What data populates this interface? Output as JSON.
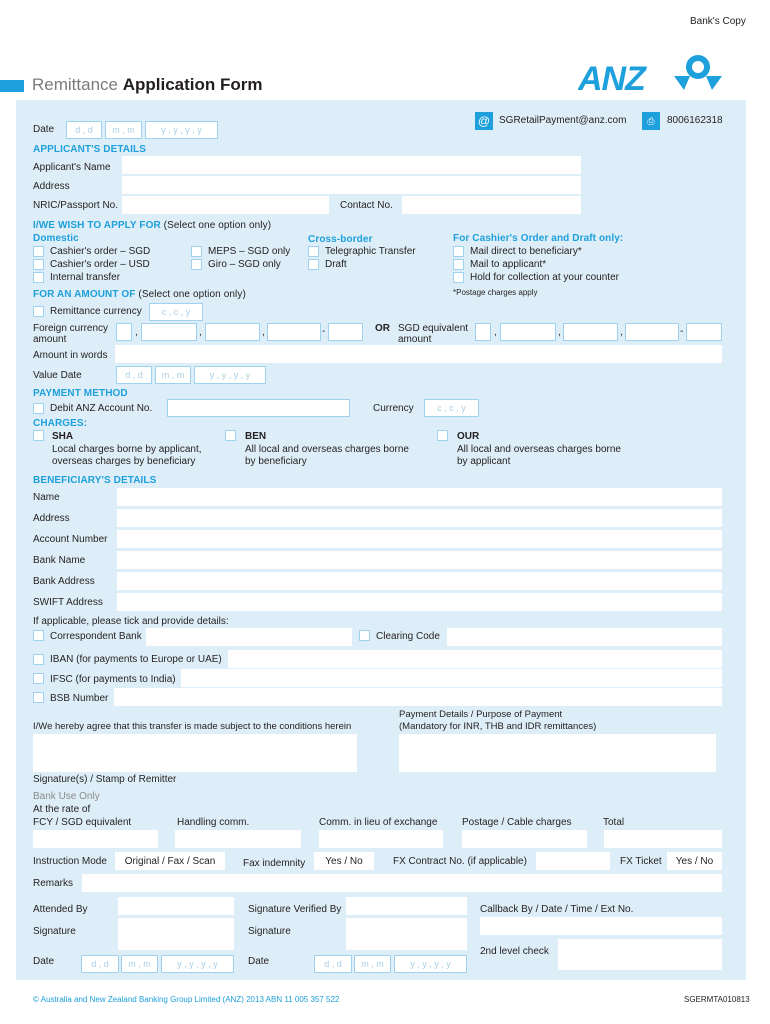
{
  "header": {
    "copy_label": "Bank's Copy",
    "title_light": "Remittance",
    "title_bold": "Application Form",
    "logo_text": "ANZ",
    "email": "SGRetailPayment@anz.com",
    "phone": "8006162318",
    "brand_color": "#1ea0dc"
  },
  "date": {
    "label": "Date",
    "dd": "d , d",
    "mm": "m , m",
    "yyyy": "y , y , y , y"
  },
  "applicant": {
    "heading": "APPLICANT'S DETAILS",
    "name_label": "Applicant's Name",
    "address_label": "Address",
    "nric_label": "NRIC/Passport No.",
    "contact_label": "Contact No."
  },
  "apply_for": {
    "heading": "I/WE WISH TO APPLY FOR",
    "heading_note": "(Select one option only)",
    "domestic_heading": "Domestic",
    "domestic_col1": [
      "Cashier's order – SGD",
      "Cashier's order – USD",
      "Internal transfer"
    ],
    "domestic_col2": [
      "MEPS – SGD only",
      "Giro  – SGD only"
    ],
    "crossborder_heading": "Cross-border",
    "crossborder": [
      "Telegraphic Transfer",
      "Draft"
    ],
    "cashier_heading": "For Cashier's Order and Draft only:",
    "cashier": [
      "Mail direct to beneficiary*",
      "Mail to applicant*",
      "Hold for collection at your counter"
    ],
    "postage_note": "*Postage charges apply"
  },
  "amount": {
    "heading": "FOR AN AMOUNT OF",
    "heading_note": "(Select one option only)",
    "remit_currency_label": "Remittance currency",
    "ccy": "c , c , y",
    "foreign_label_1": "Foreign currency",
    "foreign_label_2": "amount",
    "or_label": "OR",
    "sgd_label_1": "SGD equivalent",
    "sgd_label_2": "amount",
    "comma": ",",
    "dash": "-",
    "words_label": "Amount in words",
    "value_date_label": "Value Date"
  },
  "payment": {
    "heading": "PAYMENT METHOD",
    "debit_label": "Debit ANZ Account No.",
    "currency_label": "Currency",
    "ccy": "c , c , y"
  },
  "charges": {
    "heading": "CHARGES:",
    "options": [
      {
        "code": "SHA",
        "line1": "Local charges borne by applicant,",
        "line2": "overseas charges by beneficiary"
      },
      {
        "code": "BEN",
        "line1": "All local and overseas charges borne",
        "line2": "by beneficiary"
      },
      {
        "code": "OUR",
        "line1": "All local and overseas charges borne",
        "line2": "by applicant"
      }
    ]
  },
  "beneficiary": {
    "heading": "BENEFICIARY'S DETAILS",
    "fields": [
      "Name",
      "Address",
      "Account Number",
      "Bank Name",
      "Bank Address",
      "SWIFT Address"
    ],
    "applicable_note": "If applicable, please tick and provide details:",
    "correspondent_label": "Correspondent Bank",
    "clearing_label": "Clearing Code",
    "iban_label": "IBAN (for payments to Europe or UAE)",
    "ifsc_label": "IFSC (for payments to India)",
    "bsb_label": "BSB Number"
  },
  "agreement": {
    "agree_text": "I/We hereby agree that this transfer is made subject to the conditions herein",
    "purpose_line1": "Payment Details / Purpose of Payment",
    "purpose_line2": "(Mandatory for INR, THB and IDR remittances)",
    "signature_label": "Signature(s) / Stamp of Remitter"
  },
  "bank_use": {
    "heading": "Bank Use Only",
    "rate_label": "At the rate of",
    "columns": [
      "FCY / SGD equivalent",
      "Handling comm.",
      "Comm. in lieu of exchange",
      "Postage / Cable charges",
      "Total"
    ],
    "instruction_label": "Instruction Mode",
    "instruction_value": "Original / Fax / Scan",
    "fax_label": "Fax indemnity",
    "fax_value": "Yes / No",
    "fx_contract_label": "FX Contract No. (if applicable)",
    "fx_ticket_label": "FX Ticket",
    "fx_ticket_value": "Yes / No",
    "remarks_label": "Remarks",
    "attended_label": "Attended By",
    "sig_verified_label": "Signature Verified By",
    "callback_label": "Callback By / Date / Time / Ext No.",
    "signature_label": "Signature",
    "second_check_label": "2nd level check",
    "date_label": "Date"
  },
  "footer": {
    "copyright": "© Australia and New Zealand Banking Group Limited (ANZ) 2013 ABN 11 005 357 522",
    "code": "SGERMTA010813"
  }
}
